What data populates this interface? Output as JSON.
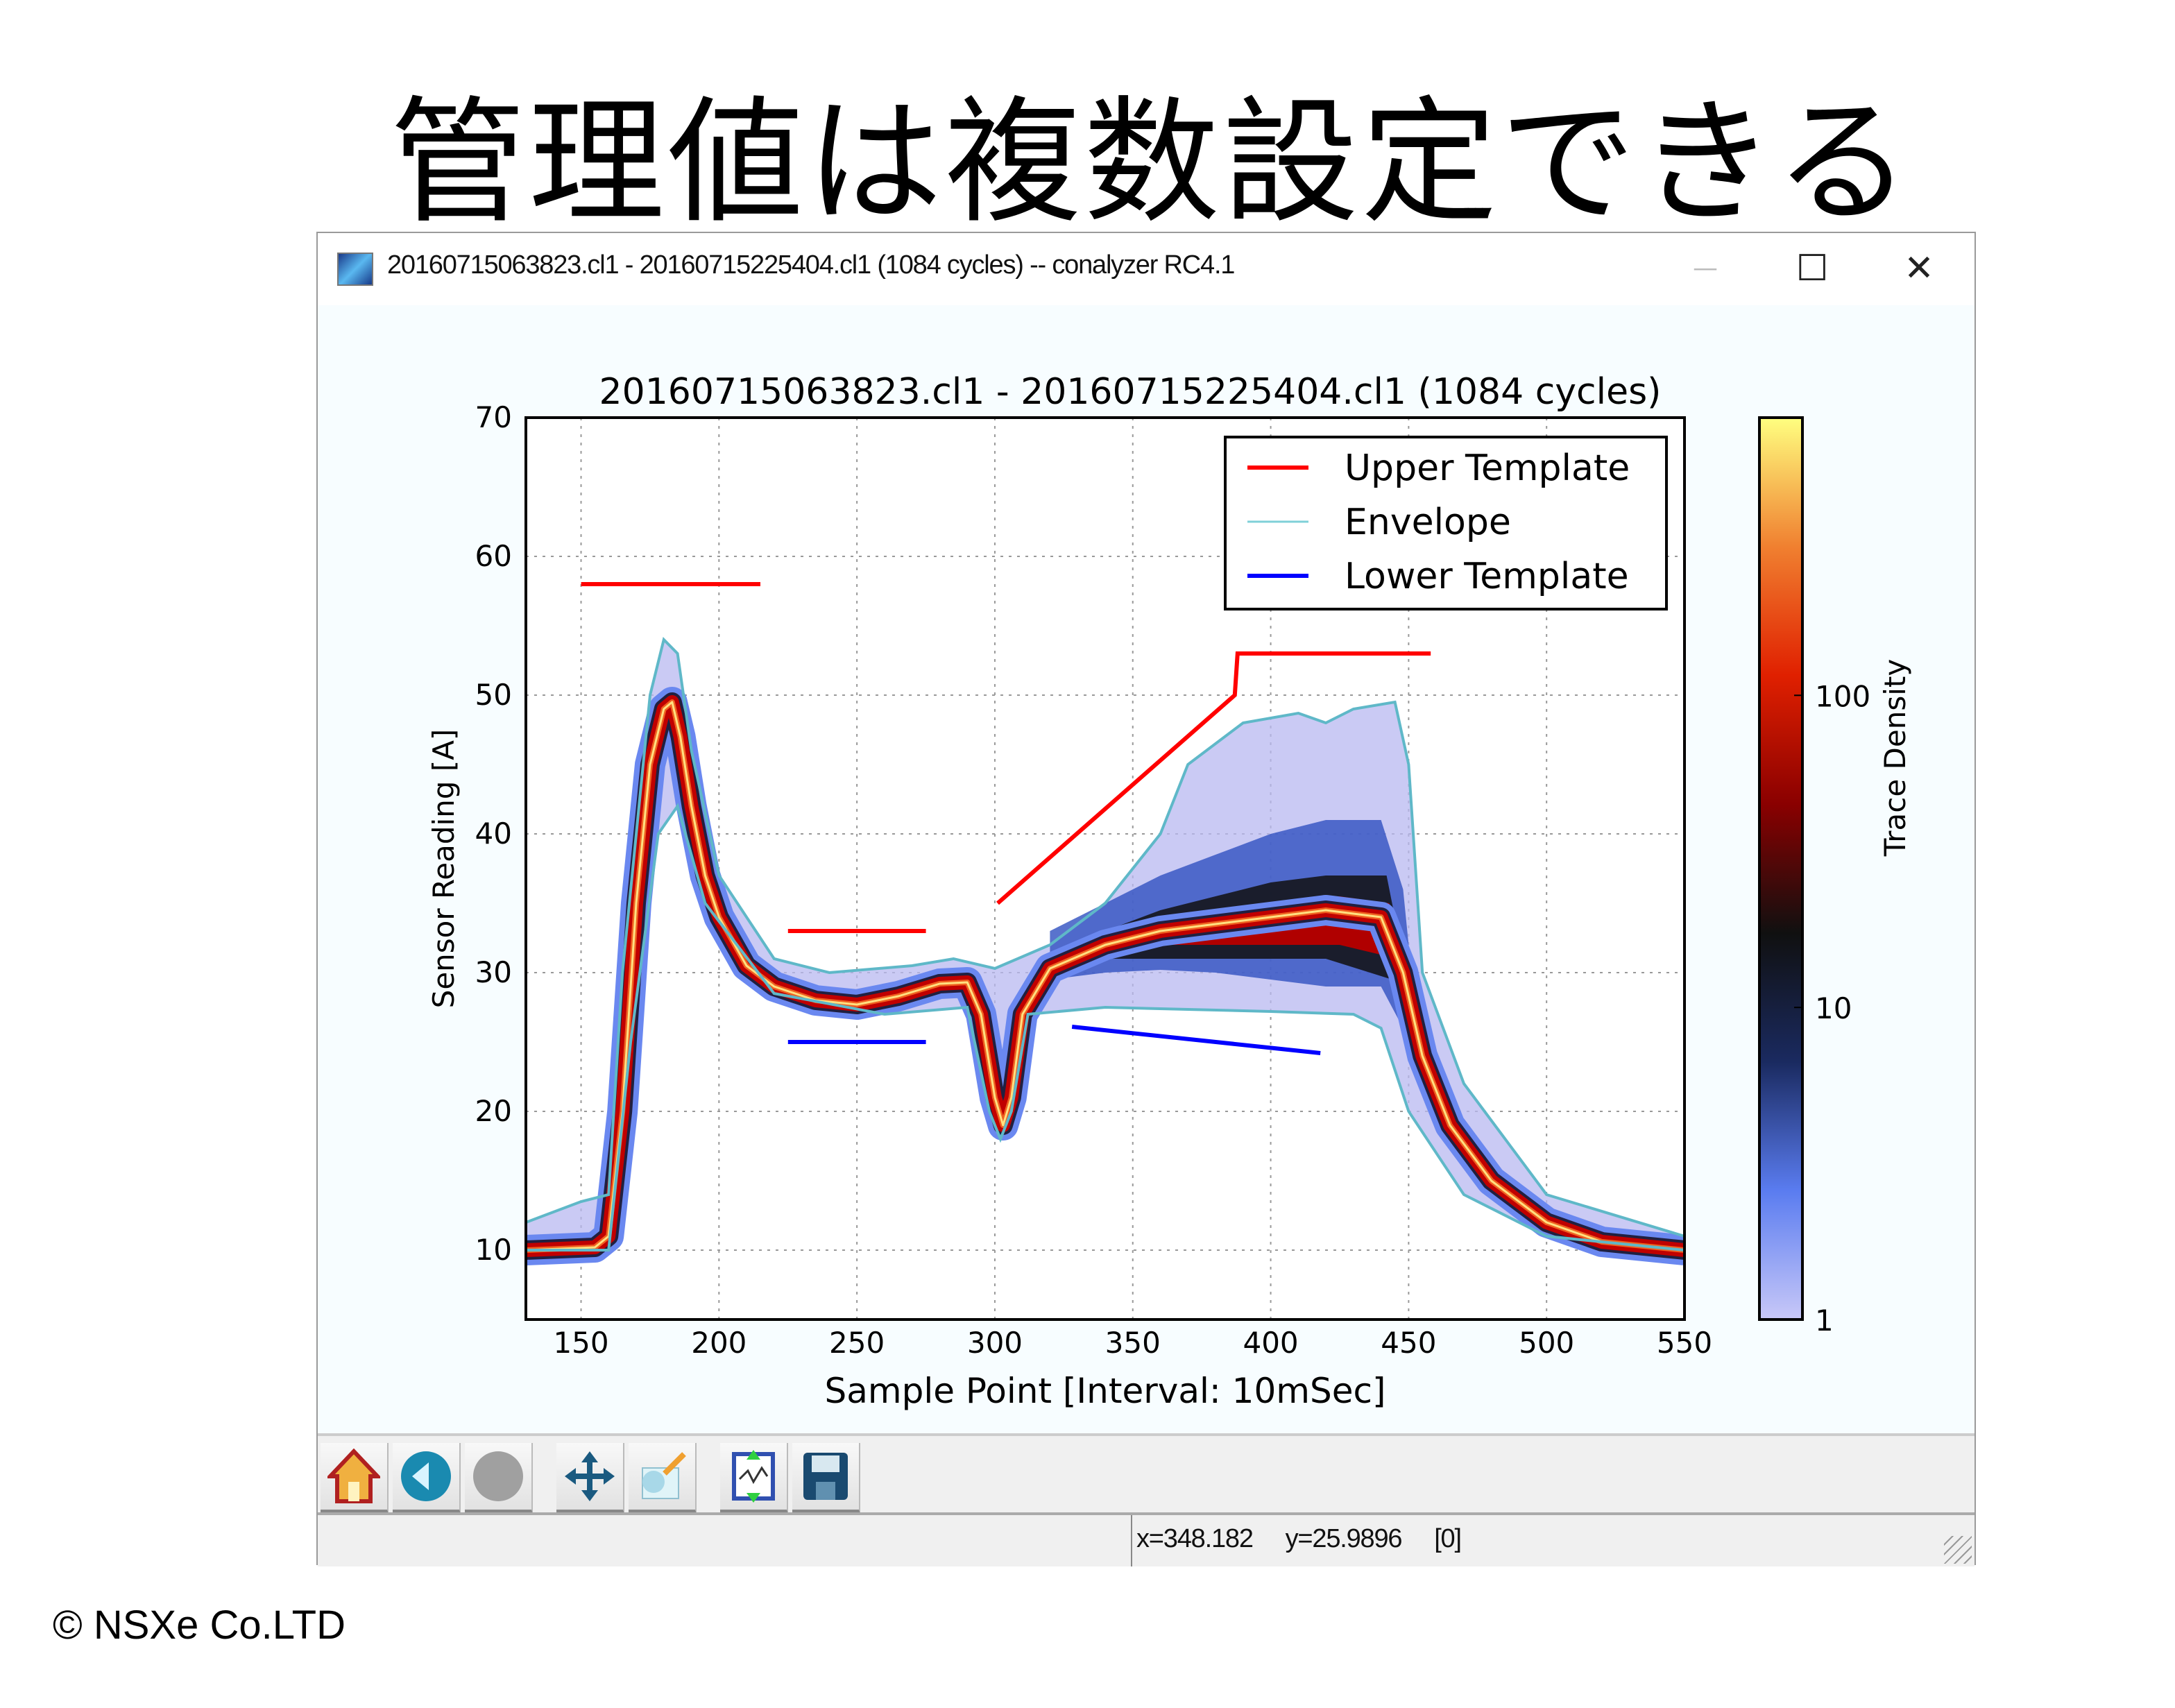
{
  "slide": {
    "title": "管理値は複数設定できる",
    "copyright": "©  NSXe Co.LTD"
  },
  "window": {
    "title": "20160715063823.cl1 - 20160715225404.cl1 (1084 cycles) -- conalyzer RC4.1",
    "controls": {
      "minimize": "—",
      "maximize": "☐",
      "close": "✕"
    },
    "icon": "app-waveform-icon"
  },
  "toolbar": {
    "buttons": [
      {
        "name": "home",
        "icon": "home-icon"
      },
      {
        "name": "back",
        "icon": "back-arrow-icon"
      },
      {
        "name": "forward",
        "icon": "forward-disabled-icon"
      },
      {
        "name": "pan",
        "icon": "move-arrows-icon"
      },
      {
        "name": "zoom",
        "icon": "zoom-rect-icon"
      },
      {
        "name": "configure-subplots",
        "icon": "subplots-icon"
      },
      {
        "name": "save",
        "icon": "floppy-disk-icon"
      }
    ]
  },
  "status": {
    "x": "x=348.182",
    "y": "y=25.9896",
    "index": "[0]"
  },
  "chart_data": {
    "type": "line",
    "title": "20160715063823.cl1 - 20160715225404.cl1 (1084 cycles)",
    "xlabel": "Sample Point [Interval: 10mSec]",
    "ylabel": "Sensor Reading [A]",
    "xlim": [
      130,
      550
    ],
    "ylim": [
      5,
      70
    ],
    "xticks": [
      150,
      200,
      250,
      300,
      350,
      400,
      450,
      500,
      550
    ],
    "yticks": [
      10,
      20,
      30,
      40,
      50,
      60,
      70
    ],
    "grid": true,
    "legend": {
      "placement": "top-right",
      "entries": [
        {
          "label": "Upper Template",
          "color": "#ff0000"
        },
        {
          "label": "Envelope",
          "color": "#7fd0d8"
        },
        {
          "label": "Lower Template",
          "color": "#0000ff"
        }
      ]
    },
    "series": [
      {
        "name": "Upper Template",
        "color": "#ff0000",
        "segments": [
          [
            [
              150,
              58
            ],
            [
              215,
              58
            ]
          ],
          [
            [
              225,
              33
            ],
            [
              275,
              33
            ]
          ],
          [
            [
              301,
              35
            ],
            [
              387,
              50
            ],
            [
              388,
              53
            ],
            [
              458,
              53
            ]
          ]
        ]
      },
      {
        "name": "Lower Template",
        "color": "#0000ff",
        "segments": [
          [
            [
              225,
              25
            ],
            [
              275,
              25
            ]
          ],
          [
            [
              328,
              26.1
            ],
            [
              418,
              24.2
            ]
          ]
        ]
      },
      {
        "name": "Envelope",
        "color": "#5fb8c8",
        "upper": [
          [
            130,
            12
          ],
          [
            150,
            13.5
          ],
          [
            160,
            14
          ],
          [
            165,
            30
          ],
          [
            175,
            50
          ],
          [
            180,
            54
          ],
          [
            185,
            53
          ],
          [
            190,
            46
          ],
          [
            200,
            37
          ],
          [
            220,
            31
          ],
          [
            240,
            30
          ],
          [
            270,
            30.5
          ],
          [
            285,
            31
          ],
          [
            300,
            30.3
          ],
          [
            320,
            32
          ],
          [
            340,
            35
          ],
          [
            360,
            40
          ],
          [
            370,
            45
          ],
          [
            390,
            48
          ],
          [
            410,
            48.7
          ],
          [
            420,
            48
          ],
          [
            430,
            49
          ],
          [
            445,
            49.5
          ],
          [
            450,
            45
          ],
          [
            455,
            30
          ],
          [
            470,
            22
          ],
          [
            500,
            14
          ],
          [
            550,
            11
          ]
        ],
        "lower": [
          [
            130,
            10
          ],
          [
            160,
            10
          ],
          [
            168,
            25
          ],
          [
            178,
            40
          ],
          [
            185,
            42
          ],
          [
            195,
            35
          ],
          [
            220,
            28.5
          ],
          [
            260,
            27
          ],
          [
            290,
            27.5
          ],
          [
            298,
            20
          ],
          [
            302,
            18
          ],
          [
            306,
            20
          ],
          [
            312,
            27
          ],
          [
            340,
            27.5
          ],
          [
            400,
            27.2
          ],
          [
            430,
            27
          ],
          [
            440,
            26
          ],
          [
            450,
            20
          ],
          [
            470,
            14
          ],
          [
            500,
            11
          ],
          [
            550,
            10
          ]
        ]
      },
      {
        "name": "density-median",
        "points": [
          [
            130,
            10
          ],
          [
            155,
            10.2
          ],
          [
            160,
            11
          ],
          [
            165,
            20
          ],
          [
            170,
            35
          ],
          [
            175,
            45
          ],
          [
            180,
            49
          ],
          [
            183,
            49.5
          ],
          [
            186,
            47
          ],
          [
            190,
            42
          ],
          [
            195,
            37
          ],
          [
            200,
            34
          ],
          [
            210,
            30.5
          ],
          [
            220,
            29
          ],
          [
            235,
            28
          ],
          [
            250,
            27.7
          ],
          [
            265,
            28.3
          ],
          [
            280,
            29.2
          ],
          [
            290,
            29.3
          ],
          [
            295,
            27
          ],
          [
            300,
            21
          ],
          [
            303,
            19
          ],
          [
            306,
            21
          ],
          [
            310,
            27
          ],
          [
            320,
            30.3
          ],
          [
            340,
            32
          ],
          [
            360,
            33
          ],
          [
            380,
            33.5
          ],
          [
            400,
            34
          ],
          [
            420,
            34.5
          ],
          [
            440,
            34
          ],
          [
            448,
            30
          ],
          [
            455,
            24
          ],
          [
            465,
            19
          ],
          [
            480,
            15
          ],
          [
            500,
            12
          ],
          [
            520,
            10.6
          ],
          [
            550,
            10
          ]
        ]
      }
    ],
    "colorbar": {
      "label": "Trace Density",
      "scale": "log",
      "range": [
        1,
        776
      ],
      "ticks": [
        1,
        10,
        100
      ],
      "colors": [
        "#c8c8f8",
        "#5a7cf0",
        "#1a2a60",
        "#101010",
        "#8a0000",
        "#e02000",
        "#f08030",
        "#ffff80"
      ]
    }
  }
}
